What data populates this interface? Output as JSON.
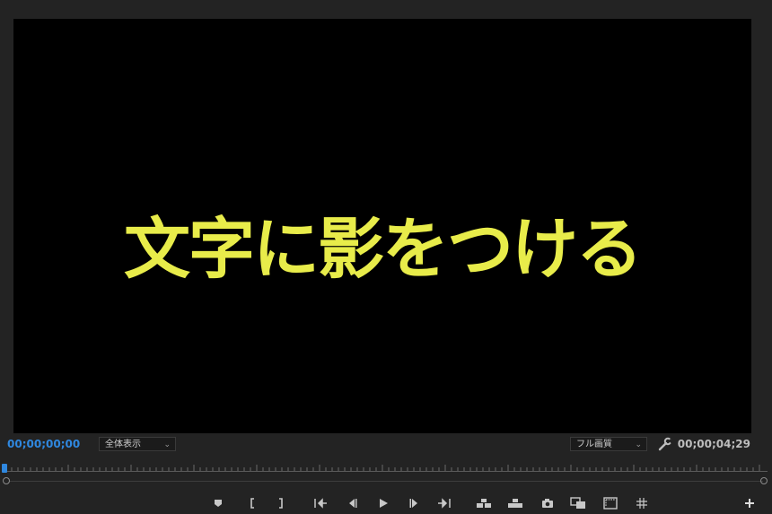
{
  "monitor": {
    "caption": "文字に影をつける",
    "caption_color": "#e8ec4a"
  },
  "info_bar": {
    "current_timecode": "00;00;00;00",
    "zoom_level": "全体表示",
    "playback_resolution": "フル画質",
    "duration_timecode": "00;00;04;29"
  },
  "colors": {
    "accent": "#2f88e0",
    "panel_bg": "#232323",
    "video_bg": "#000000"
  },
  "transport_icons": [
    "add-marker-icon",
    "mark-in-icon",
    "mark-out-icon",
    "go-to-in-icon",
    "step-back-icon",
    "play-icon",
    "step-forward-icon",
    "go-to-out-icon",
    "insert-icon",
    "overwrite-icon",
    "export-frame-icon",
    "compare-view-icon",
    "safe-margins-icon",
    "grid-icon",
    "button-editor-icon"
  ]
}
